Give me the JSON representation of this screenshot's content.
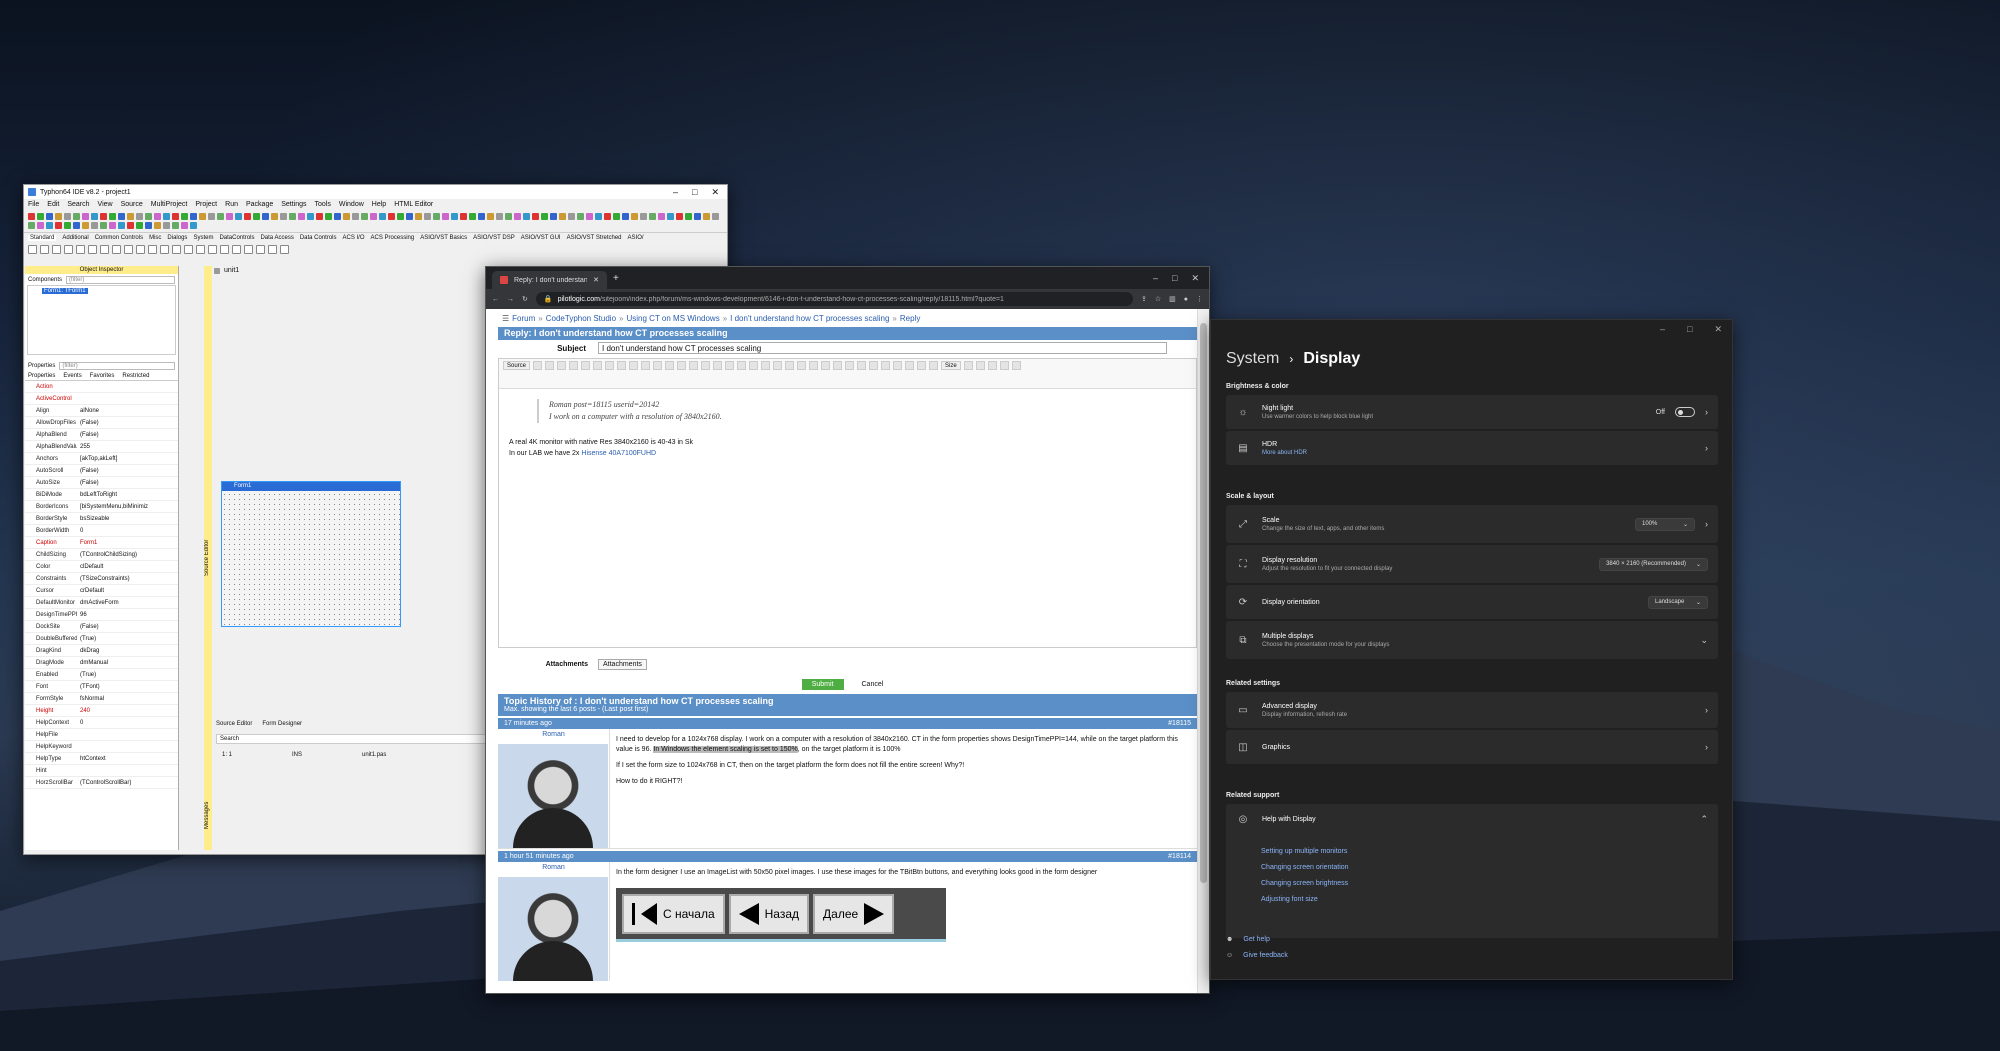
{
  "ide": {
    "title": "Typhon64 IDE v8.2 - project1",
    "menu": [
      "File",
      "Edit",
      "Search",
      "View",
      "Source",
      "MultiProject",
      "Project",
      "Run",
      "Package",
      "Settings",
      "Tools",
      "Window",
      "Help",
      "HTML Editor"
    ],
    "palette_tabs": [
      "Standard",
      "Additional",
      "Common Controls",
      "Misc",
      "Dialogs",
      "System",
      "DataControls",
      "Data Access",
      "Data Controls",
      "ACS I/O",
      "ACS Processing",
      "ASIO/VST Basics",
      "ASIO/VST DSP",
      "ASIO/VST GUI",
      "ASIO/VST Stretched",
      "ASIO/"
    ],
    "inspector_title": "Object Inspector",
    "components_label": "Components",
    "filter_placeholder": "(filter)",
    "tree_item": "Form1: TForm1",
    "properties_label": "Properties",
    "inspector_tabs": [
      "Properties",
      "Events",
      "Favorites",
      "Restricted"
    ],
    "properties": [
      {
        "n": "Action",
        "v": "",
        "red": true
      },
      {
        "n": "ActiveControl",
        "v": "",
        "red": true
      },
      {
        "n": "Align",
        "v": "alNone"
      },
      {
        "n": "AllowDropFiles",
        "v": "(False)"
      },
      {
        "n": "AlphaBlend",
        "v": "(False)"
      },
      {
        "n": "AlphaBlendValu",
        "v": "255"
      },
      {
        "n": "Anchors",
        "v": "[akTop,akLeft]"
      },
      {
        "n": "AutoScroll",
        "v": "(False)"
      },
      {
        "n": "AutoSize",
        "v": "(False)"
      },
      {
        "n": "BiDiMode",
        "v": "bdLeftToRight"
      },
      {
        "n": "BorderIcons",
        "v": "[biSystemMenu,biMinimiz"
      },
      {
        "n": "BorderStyle",
        "v": "bsSizeable"
      },
      {
        "n": "BorderWidth",
        "v": "0"
      },
      {
        "n": "Caption",
        "v": "Form1",
        "red": true
      },
      {
        "n": "ChildSizing",
        "v": "(TControlChildSizing)"
      },
      {
        "n": "Color",
        "v": "clDefault"
      },
      {
        "n": "Constraints",
        "v": "(TSizeConstraints)"
      },
      {
        "n": "Cursor",
        "v": "crDefault"
      },
      {
        "n": "DefaultMonitor",
        "v": "dmActiveForm"
      },
      {
        "n": "DesignTimePPI",
        "v": "96"
      },
      {
        "n": "DockSite",
        "v": "(False)"
      },
      {
        "n": "DoubleBuffered",
        "v": "(True)"
      },
      {
        "n": "DragKind",
        "v": "dkDrag"
      },
      {
        "n": "DragMode",
        "v": "dmManual"
      },
      {
        "n": "Enabled",
        "v": "(True)"
      },
      {
        "n": "Font",
        "v": "(TFont)"
      },
      {
        "n": "FormStyle",
        "v": "fsNormal"
      },
      {
        "n": "Height",
        "v": "240",
        "red": true
      },
      {
        "n": "HelpContext",
        "v": "0"
      },
      {
        "n": "HelpFile",
        "v": ""
      },
      {
        "n": "HelpKeyword",
        "v": ""
      },
      {
        "n": "HelpType",
        "v": "htContext"
      },
      {
        "n": "Hint",
        "v": ""
      },
      {
        "n": "HorzScrollBar",
        "v": "(TControlScrollBar)"
      }
    ],
    "unit_tab": "unit1",
    "form_caption": "Form1",
    "source_editor": "Source Editor",
    "bottom_tabs": [
      "Source Editor",
      "Form Designer"
    ],
    "search_label": "Search",
    "status": {
      "pos": "1: 1",
      "mode": "INS",
      "file": "unit1.pas"
    },
    "messages": "Messages"
  },
  "browser": {
    "tab_title": "Reply: I don't understand how CT",
    "url_host": "pilotlogic.com",
    "url_path": "/sitejoom/index.php/forum/ms-windows-development/6146-i-don-t-understand-how-ct-processes-scaling/reply/18115.html?quote=1",
    "breadcrumbs": [
      "Forum",
      "CodeTyphon Studio",
      "Using CT on MS Windows",
      "I don't understand how CT processes scaling",
      "Reply"
    ],
    "reply_heading": "Reply: I don't understand how CT processes scaling",
    "subject_label": "Subject",
    "subject_value": "I don't understand how CT processes scaling",
    "source_btn": "Source",
    "size_btn": "Size",
    "quote_line1": "Roman post=18115 userid=20142",
    "quote_line2": "I work on a computer with a resolution of 3840x2160.",
    "body_line1": "A real 4K monitor with native Res 3840x2160 is 40-43 in Sk",
    "body_line2_a": "In our LAB we have 2x",
    "body_line2_link": "Hisense 40A7100FUHD",
    "attachments_label": "Attachments",
    "attachments_btn": "Attachments",
    "submit": "Submit",
    "cancel": "Cancel",
    "history_title": "Topic History of : I don't understand how CT processes scaling",
    "history_sub": "Max. showing the last 6 posts - (Last post first)",
    "posts": [
      {
        "time": "17 minutes ago",
        "id": "#18115",
        "author": "Roman",
        "p1a": "I need to develop for a 1024x768 display. I work on a computer with a resolution of 3840x2160. CT in the form properties shows DesignTimePPI=144, while on the target platform this value is 96.",
        "p1hl": "In Windows the element scaling is set to 150%",
        "p1b": ", on the target platform it is 100%",
        "p2": "If I set the form size to 1024x768 in CT, then on the target platform the form does not fill the entire screen! Why?!",
        "p3": "How to do it RIGHT?!"
      },
      {
        "time": "1 hour 51 minutes ago",
        "id": "#18114",
        "author": "Roman",
        "p1a": "In the form designer I use an ImageList with 50x50 pixel images. I use these images for the TBitBtn buttons, and everything looks good in the form designer"
      }
    ],
    "nav_buttons": [
      "С начала",
      "Назад",
      "Далее"
    ]
  },
  "settings": {
    "crumb_parent": "System",
    "crumb_current": "Display",
    "sec_brightness": "Brightness & color",
    "night_light": {
      "title": "Night light",
      "desc": "Use warmer colors to help block blue light",
      "state": "Off"
    },
    "hdr": {
      "title": "HDR",
      "desc": "More about HDR"
    },
    "sec_scale": "Scale & layout",
    "scale": {
      "title": "Scale",
      "desc": "Change the size of text, apps, and other items",
      "value": "100%"
    },
    "resolution": {
      "title": "Display resolution",
      "desc": "Adjust the resolution to fit your connected display",
      "value": "3840 × 2160 (Recommended)"
    },
    "orientation": {
      "title": "Display orientation",
      "value": "Landscape"
    },
    "multiple": {
      "title": "Multiple displays",
      "desc": "Choose the presentation mode for your displays"
    },
    "sec_related": "Related settings",
    "advanced": {
      "title": "Advanced display",
      "desc": "Display information, refresh rate"
    },
    "graphics": {
      "title": "Graphics"
    },
    "sec_support": "Related support",
    "help": {
      "title": "Help with Display"
    },
    "help_links": [
      "Setting up multiple monitors",
      "Changing screen orientation",
      "Changing screen brightness",
      "Adjusting font size"
    ],
    "get_help": "Get help",
    "give_feedback": "Give feedback"
  }
}
